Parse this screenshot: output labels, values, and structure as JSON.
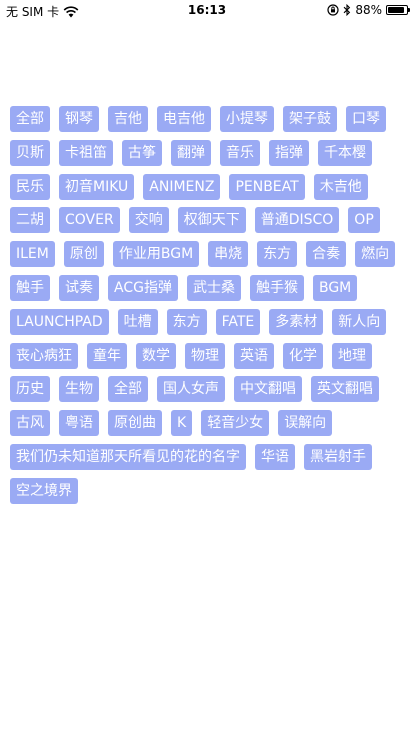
{
  "status_bar": {
    "carrier": "无 SIM 卡",
    "time": "16:13",
    "battery_percent": "88%",
    "battery_level": 0.88,
    "icons": [
      "wifi-icon",
      "orientation-lock-icon",
      "bluetooth-icon",
      "battery-icon"
    ]
  },
  "theme": {
    "tag_background": "#9aaaf4",
    "tag_text": "#ffffff",
    "page_background": "#ffffff"
  },
  "tags": [
    "全部",
    "钢琴",
    "吉他",
    "电吉他",
    "小提琴",
    "架子鼓",
    "口琴",
    "贝斯",
    "卡祖笛",
    "古筝",
    "翻弹",
    "音乐",
    "指弹",
    "千本樱",
    "民乐",
    "初音MIKU",
    "ANIMENZ",
    "PENBEAT",
    "木吉他",
    "二胡",
    "COVER",
    "交响",
    "权御天下",
    "普通DISCO",
    "OP",
    "ILEM",
    "原创",
    "作业用BGM",
    "串烧",
    "东方",
    "合奏",
    "燃向",
    "触手",
    "试奏",
    "ACG指弹",
    "武士桑",
    "触手猴",
    "BGM",
    "LAUNCHPAD",
    "吐槽",
    "东方",
    "FATE",
    "多素材",
    "新人向",
    "丧心病狂",
    "童年",
    "数学",
    "物理",
    "英语",
    "化学",
    "地理",
    "历史",
    "生物",
    "全部",
    "国人女声",
    "中文翻唱",
    "英文翻唱",
    "古风",
    "粤语",
    "原创曲",
    "K",
    "轻音少女",
    "误解向",
    "我们仍未知道那天所看见的花的名字",
    "华语",
    "黑岩射手",
    "空之境界"
  ]
}
